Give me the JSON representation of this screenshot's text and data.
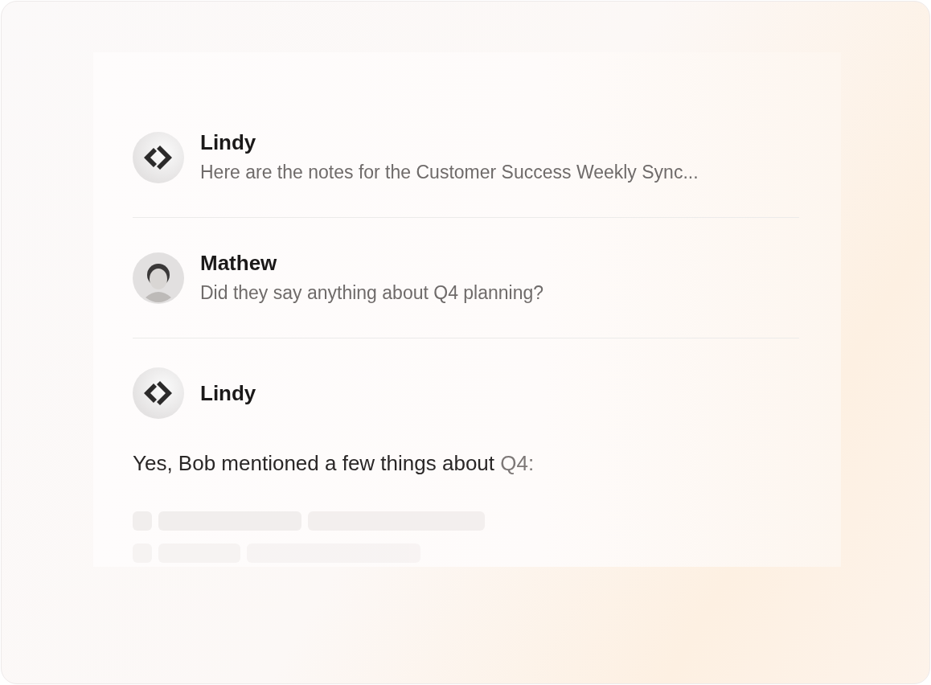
{
  "messages": [
    {
      "kind": "bot",
      "author": "Lindy",
      "text": "Here are the notes for the Customer Success Weekly Sync..."
    },
    {
      "kind": "user",
      "author": "Mathew",
      "text": "Did they say anything about Q4 planning?"
    }
  ],
  "reply": {
    "kind": "bot",
    "author": "Lindy",
    "parts": [
      {
        "text": "Yes, Bob mentioned a few things about",
        "faded": false
      },
      {
        "text": "Q4:",
        "faded": true
      }
    ]
  }
}
